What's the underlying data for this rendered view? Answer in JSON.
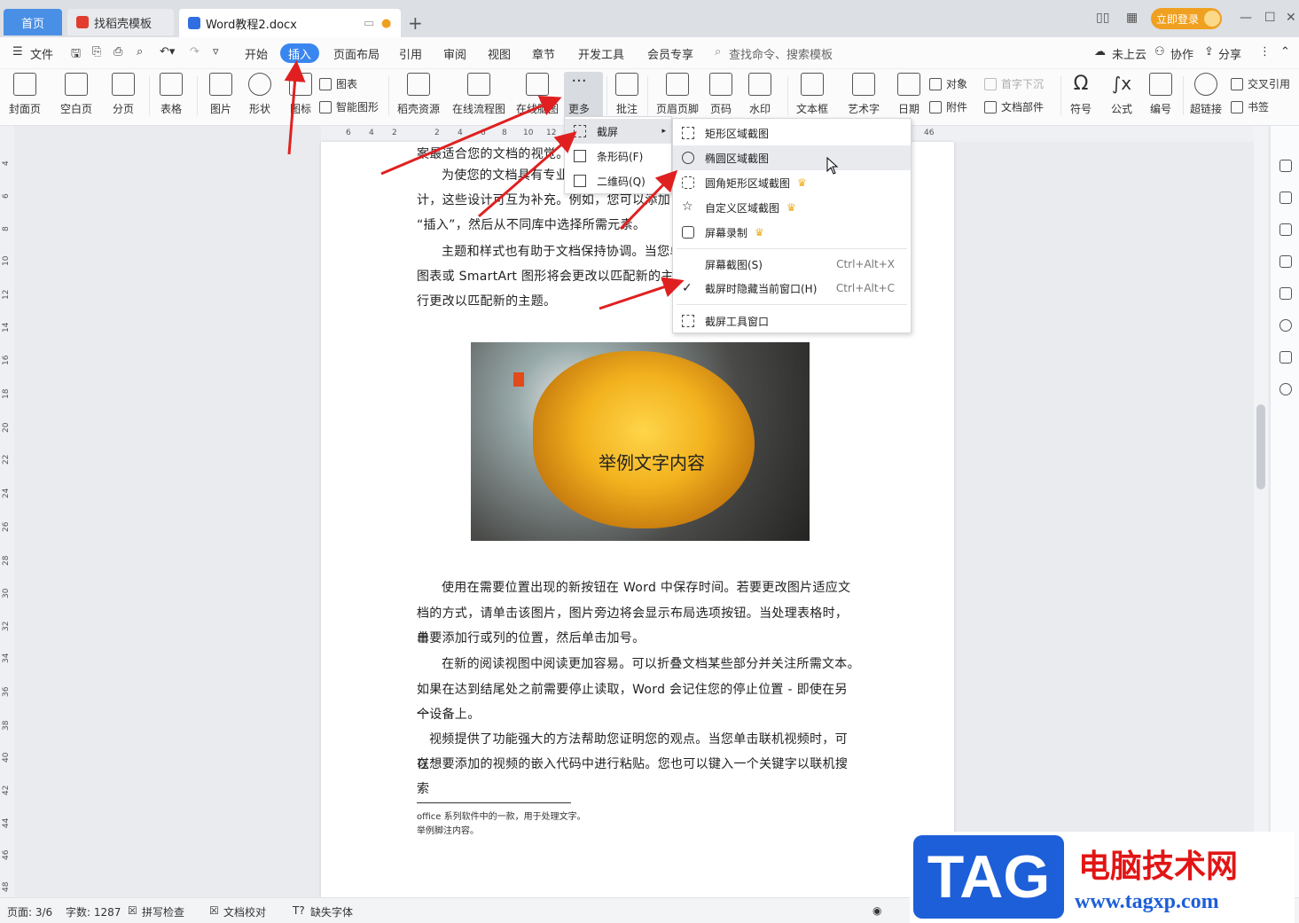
{
  "titlebar": {
    "tab_home": "首页",
    "tab_template": "找稻壳模板",
    "tab_doc": "Word教程2.docx",
    "login": "立即登录"
  },
  "menu": {
    "file": "文件",
    "items": [
      "开始",
      "插入",
      "页面布局",
      "引用",
      "审阅",
      "视图",
      "章节",
      "开发工具",
      "会员专享"
    ],
    "search": "查找命令、搜索模板",
    "cloud": "未上云",
    "collab": "协作",
    "share": "分享"
  },
  "ribbon": {
    "cover": "封面页",
    "blank": "空白页",
    "pagebreak": "分页",
    "table": "表格",
    "picture": "图片",
    "shape": "形状",
    "icon": "图标",
    "chart": "图表",
    "smartart": "智能图形",
    "docer": "稻壳资源",
    "flow": "在线流程图",
    "mind": "在线脑图",
    "more": "更多",
    "comment": "批注",
    "header": "页眉页脚",
    "pagenum": "页码",
    "watermark": "水印",
    "textbox": "文本框",
    "wordart": "艺术字",
    "date": "日期",
    "object": "对象",
    "attach": "附件",
    "dropcap": "首字下沉",
    "docpart": "文档部件",
    "symbol": "符号",
    "formula": "公式",
    "number": "编号",
    "hyperlink": "超链接",
    "crossref": "交叉引用",
    "bookmark": "书签"
  },
  "more_menu": {
    "screenshot": "截屏",
    "barcode": "条形码(F)",
    "qrcode": "二维码(Q)"
  },
  "screenshot_menu": {
    "rect": "矩形区域截图",
    "ellipse": "椭圆区域截图",
    "roundrect": "圆角矩形区域截图",
    "custom": "自定义区域截图",
    "record": "屏幕录制",
    "screen": "屏幕截图(S)",
    "screen_key": "Ctrl+Alt+X",
    "hide": "截屏时隐藏当前窗口(H)",
    "hide_key": "Ctrl+Alt+C",
    "tool": "截屏工具窗口"
  },
  "ruler": {
    "h": [
      "6",
      "4",
      "2",
      "2",
      "4",
      "6",
      "8",
      "10",
      "12",
      "46"
    ],
    "v": [
      "4",
      "6",
      "8",
      "10",
      "12",
      "14",
      "16",
      "18",
      "20",
      "22",
      "24",
      "26",
      "28",
      "30",
      "32",
      "34",
      "36",
      "38",
      "40",
      "42",
      "44",
      "46",
      "48"
    ]
  },
  "doc": {
    "p0": "案最适合您的文档的视觉。",
    "p1a": "为使您的文档具有专业",
    "p1b": "计，这些设计可互为补充。例如，您可以添加",
    "p1c": "“插入”，然后从不同库中选择所需元素。",
    "p2a": "主题和样式也有助于文档保持协调。当您单",
    "p2b": "图表或 SmartArt 图形将会更改以匹配新的主",
    "p2c": "行更改以匹配新的主题。",
    "image_text": "举例文字内容",
    "p3a": "使用在需要位置出现的新按钮在 Word 中保存时间。若要更改图片适应文",
    "p3b": "档的方式，请单击该图片，图片旁边将会显示布局选项按钮。当处理表格时，单",
    "p3c": "击要添加行或列的位置，然后单击加号。",
    "p4a": "在新的阅读视图中阅读更加容易。可以折叠文档某些部分并关注所需文本。",
    "p4b": "如果在达到结尾处之前需要停止读取，Word 会记住您的停止位置 - 即使在另一",
    "p4c": "个设备上。",
    "p5a": "视频提供了功能强大的方法帮助您证明您的观点。当您单击联机视频时，可以",
    "p5b": "在想要添加的视频的嵌入代码中进行粘贴。您也可以键入一个关键字以联机搜索",
    "fn1": "office 系列软件中的一款，用于处理文字。",
    "fn2": "举例脚注内容。"
  },
  "status": {
    "page": "页面: 3/6",
    "words": "字数: 1287",
    "spell": "拼写检查",
    "proof": "文档校对",
    "font": "缺失字体"
  },
  "watermark": {
    "tag": "TAG",
    "title": "电脑技术网",
    "url": "www.tagxp.com"
  },
  "colors": {
    "accent": "#3a86f0",
    "arrow": "#e02020",
    "crown": "#f0b020"
  }
}
